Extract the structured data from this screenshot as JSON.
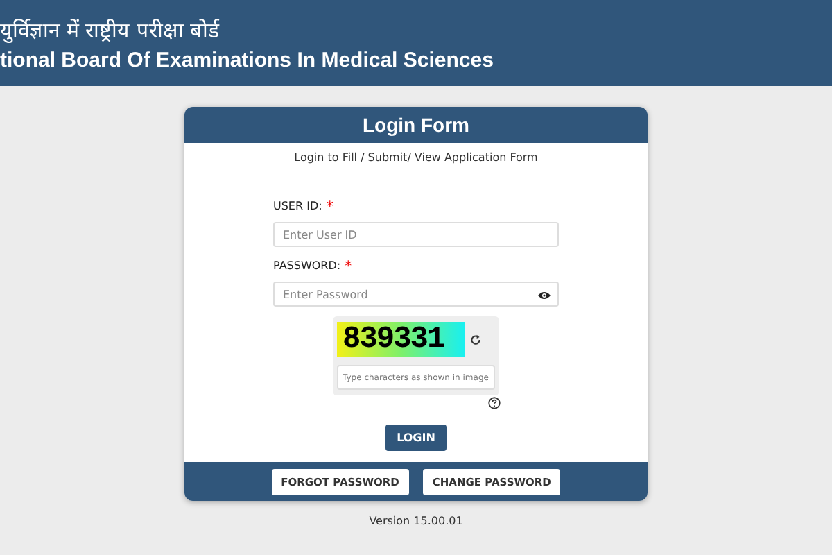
{
  "header": {
    "title_hindi": "युर्विज्ञान में राष्ट्रीय परीक्षा बोर्ड",
    "title_english": "tional Board Of Examinations In Medical Sciences"
  },
  "form": {
    "title": "Login Form",
    "subtitle": "Login to Fill / Submit/ View Application Form",
    "fields": [
      {
        "label": "USER ID:",
        "required_mark": "*",
        "placeholder": "Enter User ID",
        "kind": "text"
      },
      {
        "label": "PASSWORD:",
        "required_mark": "*",
        "placeholder": "Enter Password",
        "kind": "password"
      }
    ],
    "captcha": {
      "code": "839331",
      "placeholder": "Type characters as shown in image"
    },
    "login_button": "LOGIN",
    "footer_buttons": [
      "FORGOT PASSWORD",
      "CHANGE PASSWORD"
    ]
  },
  "version": "Version 15.00.01"
}
